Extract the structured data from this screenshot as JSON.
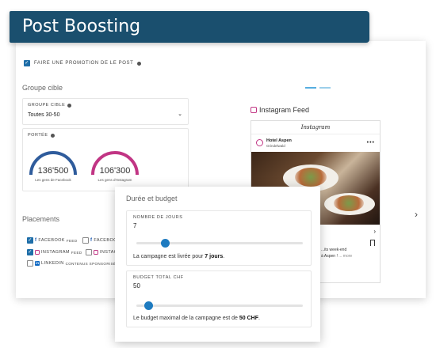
{
  "header": {
    "title": "Post Boosting"
  },
  "promo": {
    "label": "FAIRE UNE PROMOTION DE LE POST",
    "checked": true
  },
  "target": {
    "section_title": "Groupe cible",
    "group_label": "GROUPE CIBLE",
    "group_value": "Toutes 30-50",
    "reach_label": "PORTÉE",
    "gauges": [
      {
        "value": "136'500",
        "caption": "Les gens de Facebook",
        "color": "#2f5c9c"
      },
      {
        "value": "106'300",
        "caption": "Les gens d'Instagram",
        "color": "#c13584"
      }
    ]
  },
  "placements": {
    "section_title": "Placements",
    "items": [
      {
        "network": "FACEBOOK",
        "type": "FEED",
        "checked": true
      },
      {
        "network": "FACEBOOK",
        "type": "",
        "checked": false
      },
      {
        "network": "INSTAGRAM",
        "type": "FEED",
        "checked": true
      },
      {
        "network": "INSTAGR",
        "type": "",
        "checked": false
      },
      {
        "network": "LINKEDIN",
        "type": "CONTENUS SPONSORISÉS",
        "checked": false
      }
    ]
  },
  "preview": {
    "title": "Instagram Feed",
    "app_name": "Instagram",
    "account_name": "Hotel Aspen",
    "account_location": "Grindelwald",
    "caption_line1": "...its week-end",
    "caption_line2": "à Aspen ! ",
    "caption_more": "... more"
  },
  "budget": {
    "section_title": "Durée et budget",
    "days_label": "NOMBRE DE JOURS",
    "days_value": "7",
    "days_fraction": 0.17,
    "days_hint_prefix": "La campagne est livrée pour ",
    "days_hint_value": "7 jours",
    "days_hint_suffix": ".",
    "budget_label": "BUDGET TOTAL CHF",
    "budget_value": "50",
    "budget_fraction": 0.07,
    "budget_hint_prefix": "Le budget maximal de la campagne est de ",
    "budget_hint_value": "50 CHF",
    "budget_hint_suffix": "."
  },
  "colors": {
    "brand": "#1a4f6e",
    "accent": "#1e7bc0",
    "facebook": "#2f5c9c",
    "instagram": "#c13584"
  }
}
